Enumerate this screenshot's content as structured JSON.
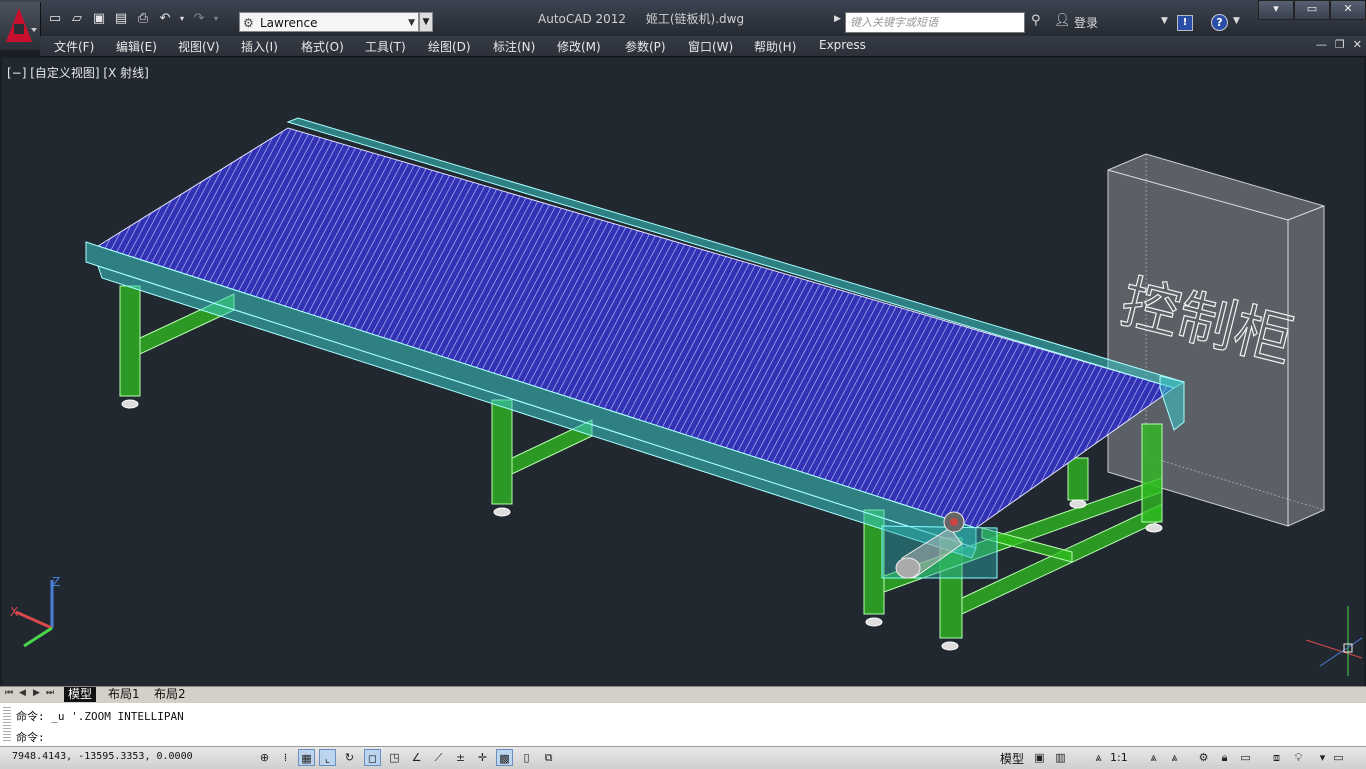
{
  "app": {
    "name": "AutoCAD 2012",
    "file": "姬工(链板机).dwg"
  },
  "workspace": {
    "value": "Lawrence"
  },
  "search": {
    "placeholder": "键入关键字或短语"
  },
  "login": {
    "label": "登录"
  },
  "menu": [
    "文件(F)",
    "编辑(E)",
    "视图(V)",
    "插入(I)",
    "格式(O)",
    "工具(T)",
    "绘图(D)",
    "标注(N)",
    "修改(M)",
    "参数(P)",
    "窗口(W)",
    "帮助(H)",
    "Express"
  ],
  "viewport": {
    "label": "[−] [自定义视图] [X 射线]",
    "cabinet_text": "控制柜",
    "ucs": {
      "x": "X",
      "z": "Z"
    }
  },
  "layout_tabs": [
    "模型",
    "布局1",
    "布局2"
  ],
  "command": {
    "history": "命令: _u '.ZOOM INTELLIPAN",
    "prompt": "命令:"
  },
  "status": {
    "coordinates": "7948.4143,  -13595.3353, 0.0000",
    "model_label": "模型",
    "annotation_scale": "1:1"
  },
  "colors": {
    "viewport_bg": "#212830",
    "belt": "#3030b0",
    "frame": "#45c8c8",
    "legs": "#33cc22",
    "cabinet": "#9a9a9a"
  }
}
